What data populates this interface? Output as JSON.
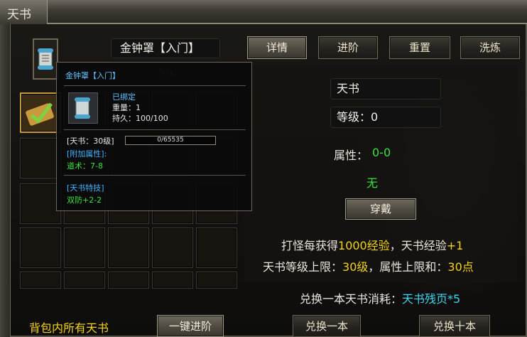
{
  "window": {
    "title": "天书"
  },
  "item": {
    "name": "金钟罩【入门】",
    "count_faint": "30"
  },
  "tabs": [
    "详情",
    "进阶",
    "重置",
    "洗炼"
  ],
  "info": {
    "name_value": "天书",
    "level_label": "等级：",
    "level_value": "0",
    "attr_label": "属性：",
    "attr_value": "0-0",
    "none_text": "无",
    "equip_button": "穿戴",
    "exp_prefix": "打怪每获得",
    "exp_amount": "1000经验",
    "exp_mid": "，天书经验",
    "exp_gain": "+1",
    "cap_prefix": "天书等级上限：",
    "cap_level": "30级",
    "cap_mid": "，属性上限和：",
    "cap_points": "30点",
    "cost_prefix": "兑换一本天书消耗：",
    "cost_item": "天书残页*5"
  },
  "bottom": {
    "bag_label": "背包内所有天书",
    "one_key_button": "一键进阶",
    "exchange_one_button": "兑换一本",
    "exchange_ten_button": "兑换十本"
  },
  "tooltip": {
    "title": "金钟罩【入门】",
    "bound": "已绑定",
    "weight": "重量：1",
    "durability": "持久：100/100",
    "level_tag": "[天书：30级]",
    "progress_text": "0/65535",
    "progress_fraction": 0,
    "extra_attr_label": "[附加属性]:",
    "extra_attr_value": "道术：7-8",
    "skill_label": "[天书特技]",
    "skill_value": "双防+2-2"
  },
  "colors": {
    "yellow": "#f5d21c",
    "green": "#39e33e",
    "cyan": "#3fd7f0",
    "tip_blue": "#3fb4ff"
  },
  "icons": [
    "scroll-icon",
    "sword-scroll-icon"
  ]
}
